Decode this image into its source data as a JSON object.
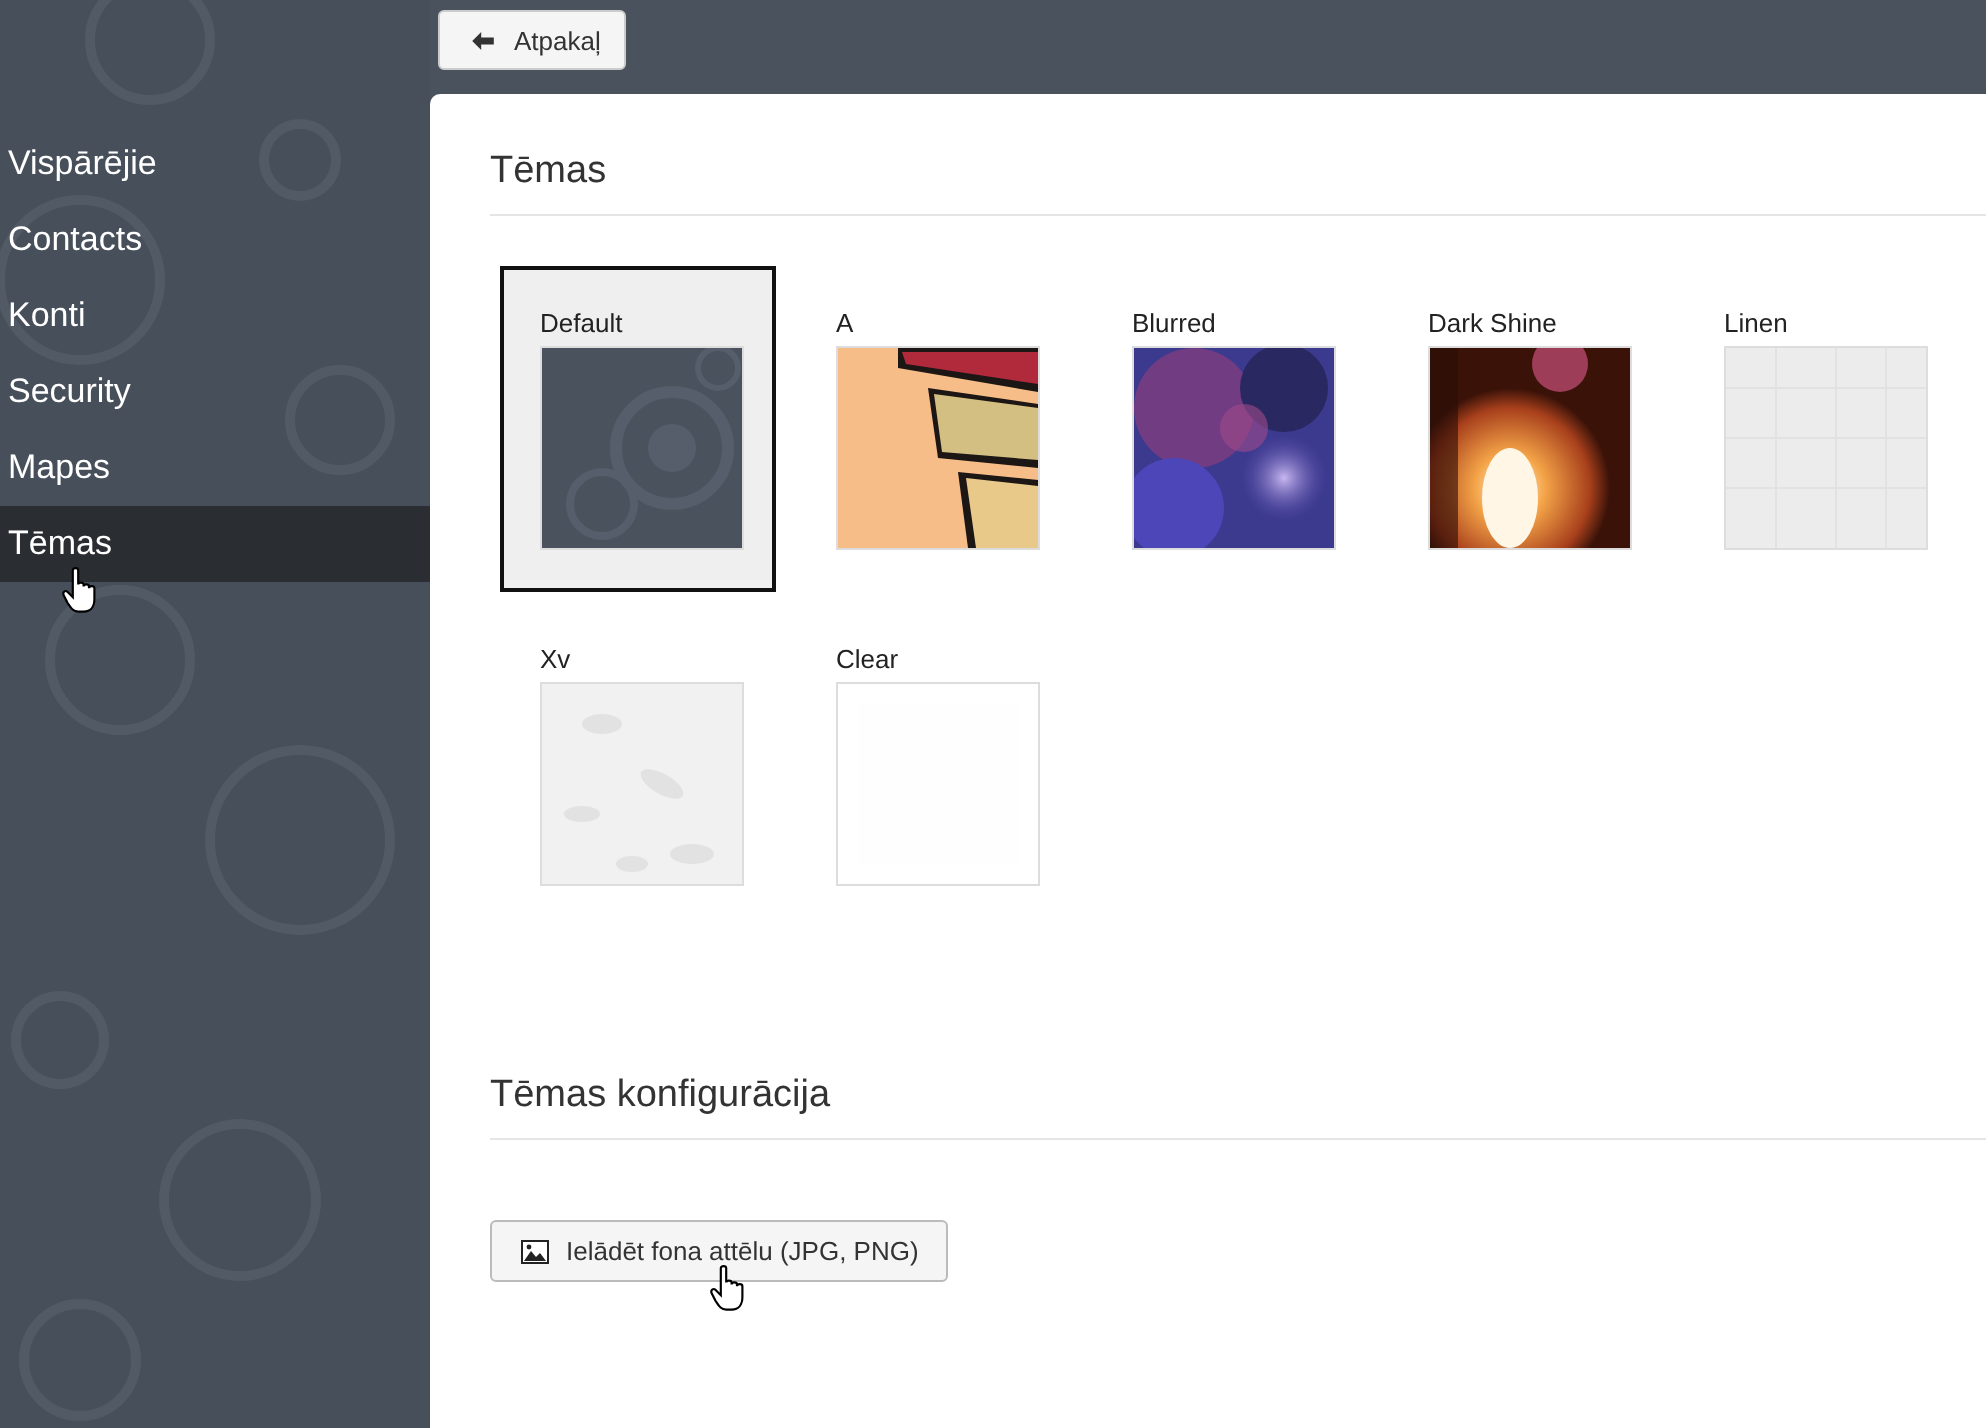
{
  "back_button": {
    "label": "Atpakaļ"
  },
  "sidebar": {
    "items": [
      {
        "label": "Vispārējie",
        "selected": false
      },
      {
        "label": "Contacts",
        "selected": false
      },
      {
        "label": "Konti",
        "selected": false
      },
      {
        "label": "Security",
        "selected": false
      },
      {
        "label": "Mapes",
        "selected": false
      },
      {
        "label": "Tēmas",
        "selected": true
      }
    ]
  },
  "themes_section": {
    "title": "Tēmas",
    "themes": [
      {
        "name": "Default",
        "selected": true
      },
      {
        "name": "A",
        "selected": false
      },
      {
        "name": "Blurred",
        "selected": false
      },
      {
        "name": "Dark Shine",
        "selected": false
      },
      {
        "name": "Linen",
        "selected": false
      },
      {
        "name": "Xv",
        "selected": false
      },
      {
        "name": "Clear",
        "selected": false
      }
    ]
  },
  "config_section": {
    "title": "Tēmas konfigurācija",
    "upload_button": {
      "label": "Ielādēt fona attēlu (JPG, PNG)"
    }
  }
}
